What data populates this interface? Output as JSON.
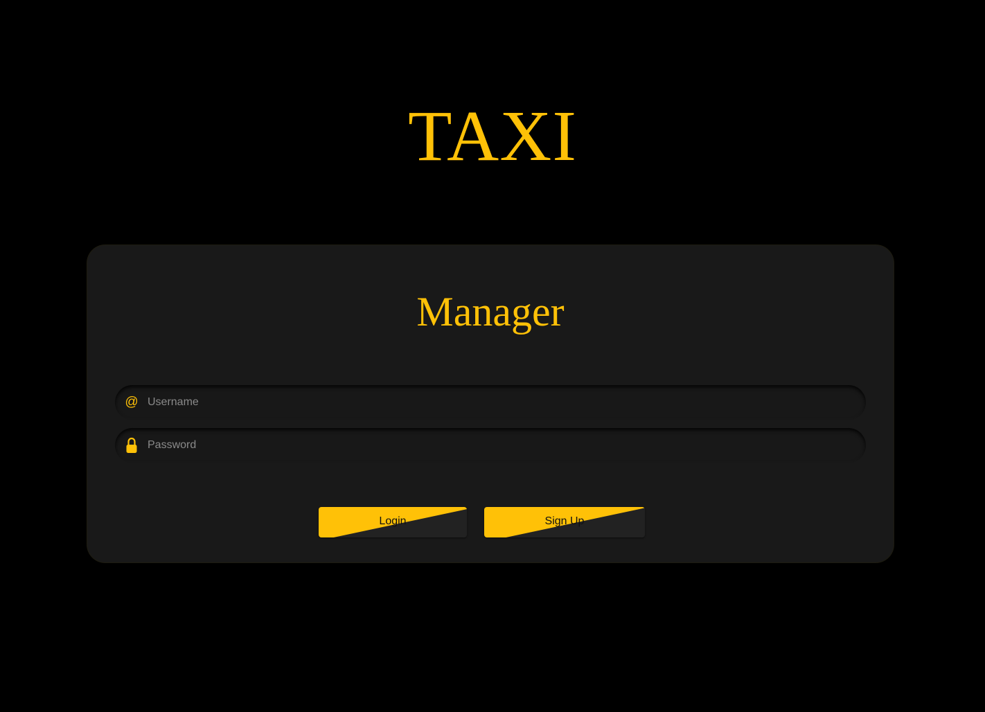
{
  "brand": {
    "title": "TAXI"
  },
  "card": {
    "title": "Manager"
  },
  "form": {
    "username": {
      "placeholder": "Username",
      "value": "",
      "icon": "at-icon"
    },
    "password": {
      "placeholder": "Password",
      "value": "",
      "icon": "lock-icon"
    }
  },
  "buttons": {
    "login": "Login",
    "signup": "Sign Up"
  },
  "colors": {
    "accent": "#ffc107",
    "background": "#000000",
    "card": "#191919",
    "field": "#181818"
  }
}
